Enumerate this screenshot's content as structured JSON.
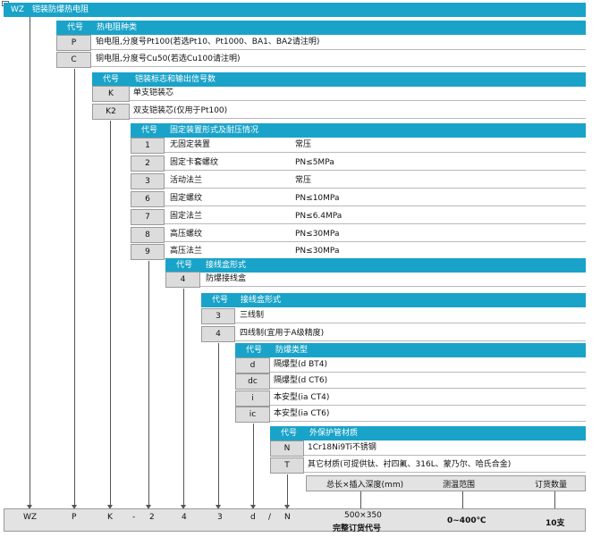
{
  "corner_mark": "1",
  "sections": [
    {
      "header_code": "WZ",
      "header_title": "铠装防爆热电阻",
      "rows": []
    },
    {
      "header_code": "代号",
      "header_title": "热电阻种类",
      "rows": [
        {
          "code": "P",
          "text": "铂电阻,分度号Pt100(若选Pt10、Pt1000、BA1、BA2请注明)",
          "extra": ""
        },
        {
          "code": "C",
          "text": "铜电阻,分度号Cu50(若选Cu100请注明)",
          "extra": ""
        }
      ]
    },
    {
      "header_code": "代号",
      "header_title": "铠装标志和输出信号数",
      "rows": [
        {
          "code": "K",
          "text": "单支铠装芯",
          "extra": ""
        },
        {
          "code": "K2",
          "text": "双支铠装芯(仅用于Pt100)",
          "extra": ""
        }
      ]
    },
    {
      "header_code": "代号",
      "header_title": "固定装置形式及耐压情况",
      "rows": [
        {
          "code": "1",
          "text": "无固定装置",
          "extra": "常压"
        },
        {
          "code": "2",
          "text": "固定卡套螺纹",
          "extra": "PN≤5MPa"
        },
        {
          "code": "3",
          "text": "活动法兰",
          "extra": "常压"
        },
        {
          "code": "6",
          "text": "固定螺纹",
          "extra": "PN≤10MPa"
        },
        {
          "code": "7",
          "text": "固定法兰",
          "extra": "PN≤6.4MPa"
        },
        {
          "code": "8",
          "text": "高压螺纹",
          "extra": "PN≤30MPa"
        },
        {
          "code": "9",
          "text": "高压法兰",
          "extra": "PN≤30MPa"
        }
      ]
    },
    {
      "header_code": "代号",
      "header_title": "接线盒形式",
      "rows": [
        {
          "code": "4",
          "text": "防爆接线盒",
          "extra": ""
        }
      ]
    },
    {
      "header_code": "代号",
      "header_title": "接线盒形式",
      "rows": [
        {
          "code": "3",
          "text": "三线制",
          "extra": ""
        },
        {
          "code": "4",
          "text": "四线制(宜用于A级精度)",
          "extra": ""
        }
      ]
    },
    {
      "header_code": "代号",
      "header_title": "防爆类型",
      "rows": [
        {
          "code": "d",
          "text": "隔爆型(d BT4)",
          "extra": ""
        },
        {
          "code": "dc",
          "text": "隔爆型(d CT6)",
          "extra": ""
        },
        {
          "code": "i",
          "text": "本安型(ia CT4)",
          "extra": ""
        },
        {
          "code": "ic",
          "text": "本安型(ia CT6)",
          "extra": ""
        }
      ]
    },
    {
      "header_code": "代号",
      "header_title": "外保护管材质",
      "rows": [
        {
          "code": "N",
          "text": "1Cr18Ni9Ti不锈钢",
          "extra": ""
        },
        {
          "code": "T",
          "text": "其它材质(可提供钛、衬四氟、316L、蒙乃尔、哈氏合金)",
          "extra": ""
        }
      ]
    }
  ],
  "extra_headers": {
    "length": "总长×插入深度(mm)",
    "range": "测温范围",
    "qty": "订货数量"
  },
  "example": {
    "codes": [
      "WZ",
      "P",
      "K",
      "-",
      "2",
      "4",
      "3",
      "d",
      "/",
      "N"
    ],
    "length": "500×350",
    "caption": "完整订货代号",
    "range": "0~400℃",
    "qty": "10支"
  }
}
